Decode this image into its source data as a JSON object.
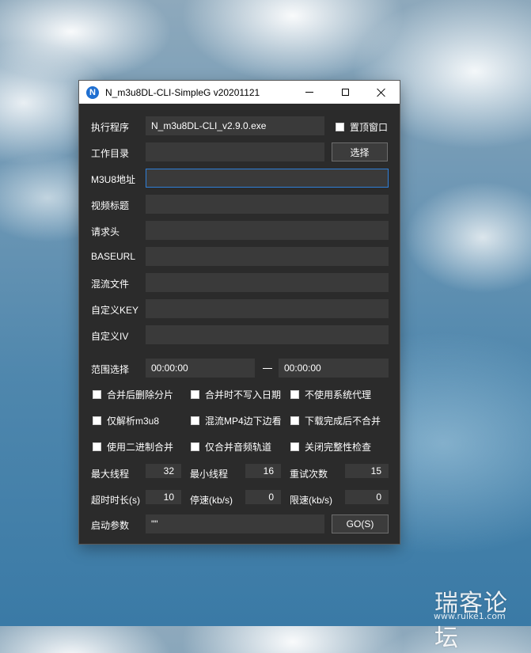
{
  "window": {
    "app_icon_letter": "N",
    "title": "N_m3u8DL-CLI-SimpleG v20201121"
  },
  "fields": {
    "exe": {
      "label": "执行程序",
      "value": "N_m3u8DL-CLI_v2.9.0.exe"
    },
    "workdir": {
      "label": "工作目录",
      "value": ""
    },
    "m3u8": {
      "label": "M3U8地址",
      "value": ""
    },
    "video_title": {
      "label": "视频标题",
      "value": ""
    },
    "headers": {
      "label": "请求头",
      "value": ""
    },
    "baseurl": {
      "label": "BASEURL",
      "value": ""
    },
    "mux_file": {
      "label": "混流文件",
      "value": ""
    },
    "custom_key": {
      "label": "自定义KEY",
      "value": ""
    },
    "custom_iv": {
      "label": "自定义IV",
      "value": ""
    }
  },
  "topmost": {
    "label": "置顶窗口",
    "checked": false
  },
  "browse_button": "选择",
  "range": {
    "label": "范围选择",
    "start": "00:00:00",
    "separator": "—",
    "end": "00:00:00"
  },
  "options": [
    {
      "label": "合并后删除分片",
      "checked": false
    },
    {
      "label": "合并时不写入日期",
      "checked": false
    },
    {
      "label": "不使用系统代理",
      "checked": false
    },
    {
      "label": "仅解析m3u8",
      "checked": false
    },
    {
      "label": "混流MP4边下边看",
      "checked": false
    },
    {
      "label": "下载完成后不合并",
      "checked": false
    },
    {
      "label": "使用二进制合并",
      "checked": false
    },
    {
      "label": "仅合并音频轨道",
      "checked": false
    },
    {
      "label": "关闭完整性检查",
      "checked": false
    }
  ],
  "numbers": {
    "max_threads": {
      "label": "最大线程",
      "value": "32"
    },
    "min_threads": {
      "label": "最小线程",
      "value": "16"
    },
    "retry_count": {
      "label": "重试次数",
      "value": "15"
    },
    "timeout": {
      "label": "超时时长(s)",
      "value": "10"
    },
    "stop_speed": {
      "label": "停速(kb/s)",
      "value": "0"
    },
    "limit_speed": {
      "label": "限速(kb/s)",
      "value": "0"
    }
  },
  "launch": {
    "label": "启动参数",
    "value": "\"\"",
    "go_button": "GO(S)"
  },
  "watermark": {
    "text": "瑞客论坛",
    "url": "www.ruike1.com"
  },
  "colors": {
    "window_bg": "#2b2b2b",
    "field_bg": "#3a3a3a",
    "focus_border": "#2f7fd8"
  }
}
